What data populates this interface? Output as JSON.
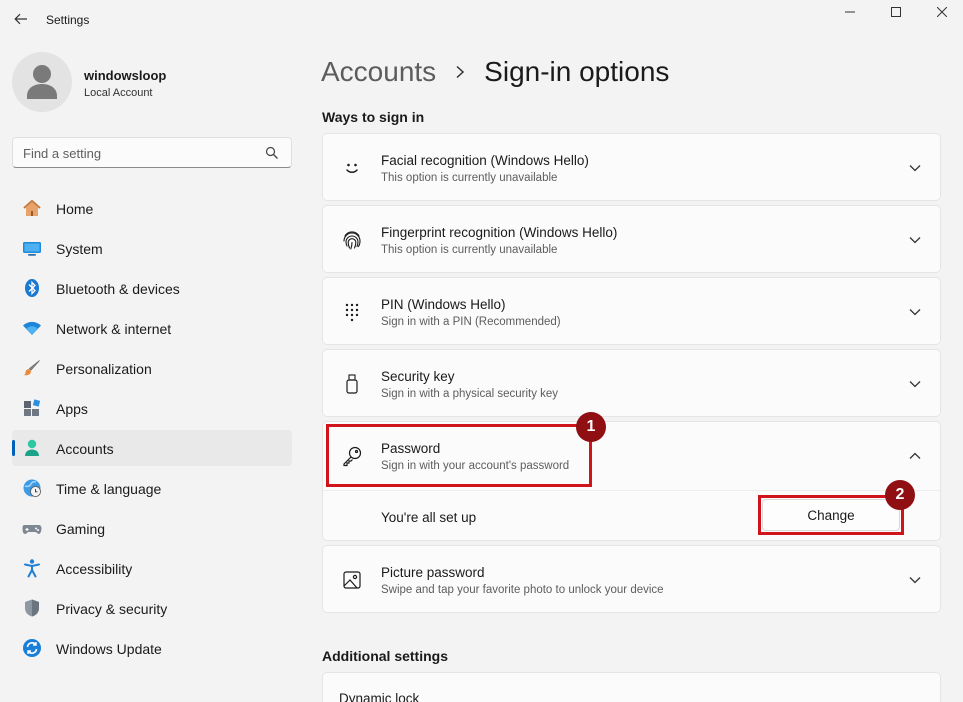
{
  "window": {
    "title": "Settings"
  },
  "profile": {
    "name": "windowsloop",
    "account_type": "Local Account"
  },
  "search": {
    "placeholder": "Find a setting"
  },
  "nav": {
    "items": [
      {
        "label": "Home",
        "icon": "home-icon"
      },
      {
        "label": "System",
        "icon": "system-icon"
      },
      {
        "label": "Bluetooth & devices",
        "icon": "bluetooth-icon"
      },
      {
        "label": "Network & internet",
        "icon": "wifi-icon"
      },
      {
        "label": "Personalization",
        "icon": "brush-icon"
      },
      {
        "label": "Apps",
        "icon": "apps-icon"
      },
      {
        "label": "Accounts",
        "icon": "accounts-icon",
        "active": true
      },
      {
        "label": "Time & language",
        "icon": "globe-clock-icon"
      },
      {
        "label": "Gaming",
        "icon": "gamepad-icon"
      },
      {
        "label": "Accessibility",
        "icon": "accessibility-icon"
      },
      {
        "label": "Privacy & security",
        "icon": "shield-icon"
      },
      {
        "label": "Windows Update",
        "icon": "update-icon"
      }
    ]
  },
  "breadcrumb": {
    "parent": "Accounts",
    "current": "Sign-in options"
  },
  "ways": {
    "heading": "Ways to sign in",
    "options": [
      {
        "title": "Facial recognition (Windows Hello)",
        "subtitle": "This option is currently unavailable",
        "icon": "face-icon"
      },
      {
        "title": "Fingerprint recognition (Windows Hello)",
        "subtitle": "This option is currently unavailable",
        "icon": "fingerprint-icon"
      },
      {
        "title": "PIN (Windows Hello)",
        "subtitle": "Sign in with a PIN (Recommended)",
        "icon": "pin-keypad-icon"
      },
      {
        "title": "Security key",
        "subtitle": "Sign in with a physical security key",
        "icon": "usb-key-icon"
      },
      {
        "title": "Password",
        "subtitle": "Sign in with your account's password",
        "icon": "key-icon",
        "expanded": true
      },
      {
        "title": "Picture password",
        "subtitle": "Swipe and tap your favorite photo to unlock your device",
        "icon": "picture-icon"
      }
    ],
    "password_detail": {
      "status": "You're all set up",
      "button": "Change"
    }
  },
  "additional": {
    "heading": "Additional settings",
    "first_item": "Dynamic lock"
  },
  "annotations": {
    "step1": "1",
    "step2": "2",
    "color": "#d0141c",
    "badge_color": "#8f0f12"
  },
  "colors": {
    "accent": "#005fb8",
    "background": "#f3f3f3",
    "card": "#fbfbfb"
  }
}
